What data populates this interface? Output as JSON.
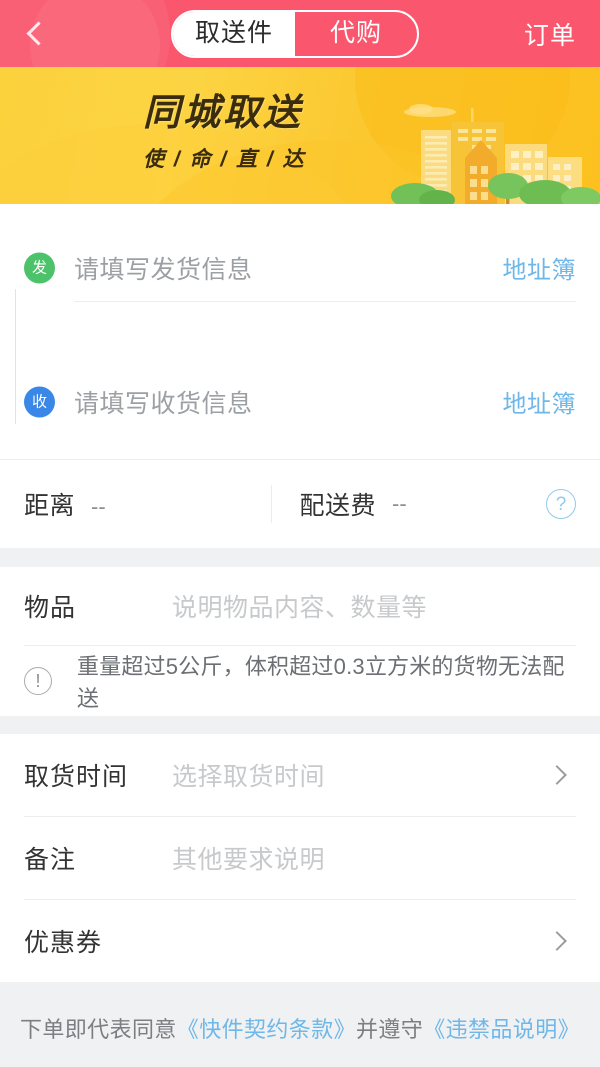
{
  "header": {
    "back_icon": "chevron-left-icon",
    "tabs": [
      {
        "label": "取送件",
        "active": true
      },
      {
        "label": "代购",
        "active": false
      }
    ],
    "action_label": "订单",
    "background_color": "#fa576e"
  },
  "banner": {
    "title": "同城取送",
    "subtitle": "使 / 命 / 直 / 达",
    "background_color": "#fbc92f",
    "title_color": "#3a2c0e",
    "illustration": "city-skyline-illustration"
  },
  "address": {
    "sender": {
      "badge": "发",
      "badge_color": "#4cc36a",
      "placeholder": "请填写发货信息",
      "link_label": "地址簿"
    },
    "receiver": {
      "badge": "收",
      "badge_color": "#3a87e8",
      "placeholder": "请填写收货信息",
      "link_label": "地址簿"
    },
    "link_color": "#6fb7e8"
  },
  "meta": {
    "distance_label": "距离",
    "distance_value": "--",
    "fee_label": "配送费",
    "fee_value": "--",
    "help_icon": "question-mark-icon"
  },
  "goods": {
    "label": "物品",
    "placeholder": "说明物品内容、数量等",
    "warning_icon": "exclamation-circle-icon",
    "warning_text": "重量超过5公斤，体积超过0.3立方米的货物无法配送"
  },
  "options": [
    {
      "label": "取货时间",
      "placeholder": "选择取货时间",
      "chevron": true
    },
    {
      "label": "备注",
      "placeholder": "其他要求说明",
      "chevron": false
    },
    {
      "label": "优惠券",
      "placeholder": "",
      "chevron": true
    }
  ],
  "footer": {
    "prefix": "下单即代表同意",
    "link1": "《快件契约条款》",
    "middle": "并遵守",
    "link2": "《违禁品说明》",
    "link_color": "#6fb7e8"
  }
}
